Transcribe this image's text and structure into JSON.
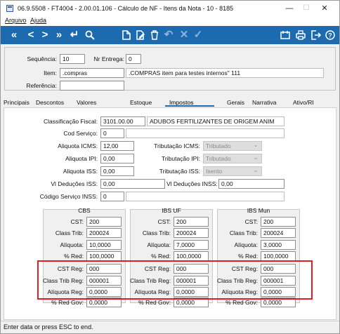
{
  "window": {
    "title": "06.9.5508 - FT4004 - 2.00.01.106 - Cálculo de NF - Itens da Nota - 10 - 8185",
    "min": "—",
    "max": "☐",
    "close": "✕"
  },
  "menu": {
    "file": "Arquivo",
    "help": "Ajuda"
  },
  "header": {
    "seq_label": "Sequência:",
    "seq_value": "10",
    "entrega_label": "Nr Entrega:",
    "entrega_value": "0",
    "item_label": "Item:",
    "item_code": ".compras",
    "item_desc": ".COMPRAS item para testes internos\" 111",
    "ref_label": "Referência:",
    "ref_value": ""
  },
  "tabs": [
    "Principais",
    "Descontos",
    "Valores",
    "Estoque",
    "Impostos",
    "Gerais",
    "Narrativa",
    "Ativo/RI"
  ],
  "form": {
    "classif_label": "Classificação Fiscal:",
    "classif_code": "3101.00.00",
    "classif_desc": "ADUBOS FERTILIZANTES DE ORIGEM ANIM",
    "codserv_label": "Cod Serviço:",
    "codserv_value": "0",
    "codserv_desc": "",
    "aliq_icms_label": "Aliquota ICMS:",
    "aliq_icms": "12,00",
    "trib_icms_label": "Tributação ICMS:",
    "trib_icms": "Tributado",
    "aliq_ipi_label": "Aliquota IPI:",
    "aliq_ipi": "0,00",
    "trib_ipi_label": "Tributação IPI:",
    "trib_ipi": "Tributado",
    "aliq_iss_label": "Aliquota ISS:",
    "aliq_iss": "0,00",
    "trib_iss_label": "Tributação ISS:",
    "trib_iss": "Isento",
    "vl_ded_iss_label": "Vl Deduções ISS:",
    "vl_ded_iss": "0,00",
    "vl_ded_inss_label": "Vl Deduções INSS:",
    "vl_ded_inss": "0,00",
    "cod_inss_label": "Código Serviço INSS:",
    "cod_inss": "0",
    "cod_inss_desc": ""
  },
  "groups": [
    {
      "title": "CBS",
      "cst": "200",
      "class_trib": "200024",
      "aliquota": "10,0000",
      "red": "100,0000",
      "cst_reg": "000",
      "class_trib_reg": "000001",
      "aliq_reg": "0,0000",
      "red_gov": "0,0000"
    },
    {
      "title": "IBS UF",
      "cst": "200",
      "class_trib": "200024",
      "aliquota": "7,0000",
      "red": "100,0000",
      "cst_reg": "000",
      "class_trib_reg": "000001",
      "aliq_reg": "0,0000",
      "red_gov": "0,0000"
    },
    {
      "title": "IBS Mun",
      "cst": "200",
      "class_trib": "200024",
      "aliquota": "3,0000",
      "red": "100,0000",
      "cst_reg": "000",
      "class_trib_reg": "000001",
      "aliq_reg": "0,0000",
      "red_gov": "0,0000"
    }
  ],
  "group_labels": {
    "cst": "CST:",
    "class_trib": "Class Trib:",
    "aliquota": "Alíquota:",
    "red": "% Red:",
    "cst_reg": "CST Reg:",
    "class_trib_reg": "Class Trib Reg:",
    "aliq_reg": "Alíquota Reg:",
    "red_gov": "% Red Gov:"
  },
  "status": "Enter data or press ESC to end."
}
